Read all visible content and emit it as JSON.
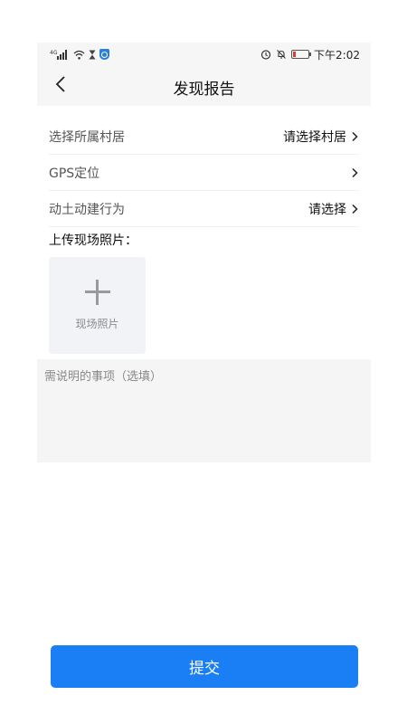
{
  "status_bar": {
    "network_label": "4G",
    "time": "下午2:02",
    "icons": [
      "signal-icon",
      "wifi-icon",
      "hourglass-icon",
      "shield-icon",
      "alarm-icon",
      "mute-icon",
      "battery-low-icon"
    ],
    "battery_color": "#e53935"
  },
  "header": {
    "title": "发现报告",
    "back_icon": "chevron-left-icon"
  },
  "form": {
    "rows": [
      {
        "label": "选择所属村居",
        "value": "请选择村居"
      },
      {
        "label": "GPS定位",
        "value": ""
      },
      {
        "label": "动土动建行为",
        "value": "请选择"
      }
    ],
    "upload_title": "上传现场照片：",
    "upload_label": "现场照片",
    "notes_placeholder": "需说明的事项（选填）",
    "notes_value": ""
  },
  "submit": {
    "label": "提交",
    "color": "#1a7ff5"
  }
}
